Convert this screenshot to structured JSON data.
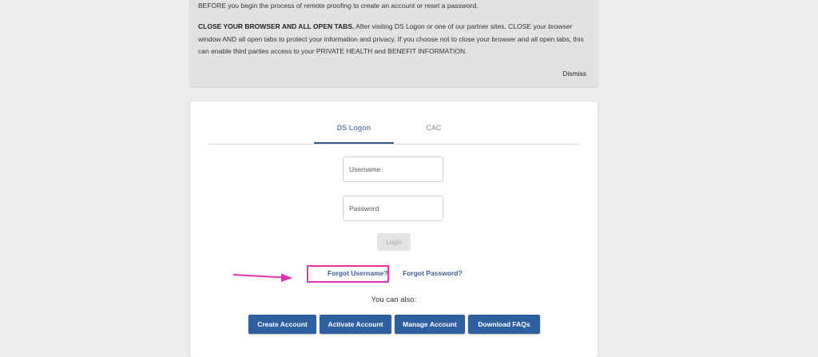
{
  "notice": {
    "line1": "BEFORE you begin the process of remote proofing to create an account or reset a password.",
    "close_heading": "CLOSE YOUR BROWSER AND ALL OPEN TABS.",
    "close_body": "After visiting DS Logon or one of our partner sites, CLOSE your browser window AND all open tabs to protect your information and privacy. If you choose not to close your browser and all open tabs, this can enable third parties access to your PRIVATE HEALTH and BENEFIT INFORMATION.",
    "dismiss": "Dismiss"
  },
  "tabs": {
    "ds_logon": "DS Logon",
    "cac": "CAC"
  },
  "form": {
    "username_placeholder": "Username",
    "password_placeholder": "Password",
    "login_label": "Login"
  },
  "links": {
    "forgot_username": "Forgot Username?",
    "forgot_password": "Forgot Password?"
  },
  "also_text": "You can also:",
  "actions": {
    "create": "Create Account",
    "activate": "Activate Account",
    "manage": "Manage Account",
    "faq": "Download FAQs"
  },
  "colors": {
    "primary_button": "#2f5fa1",
    "link": "#3a5f9c",
    "highlight_annotation": "#e233b3"
  }
}
